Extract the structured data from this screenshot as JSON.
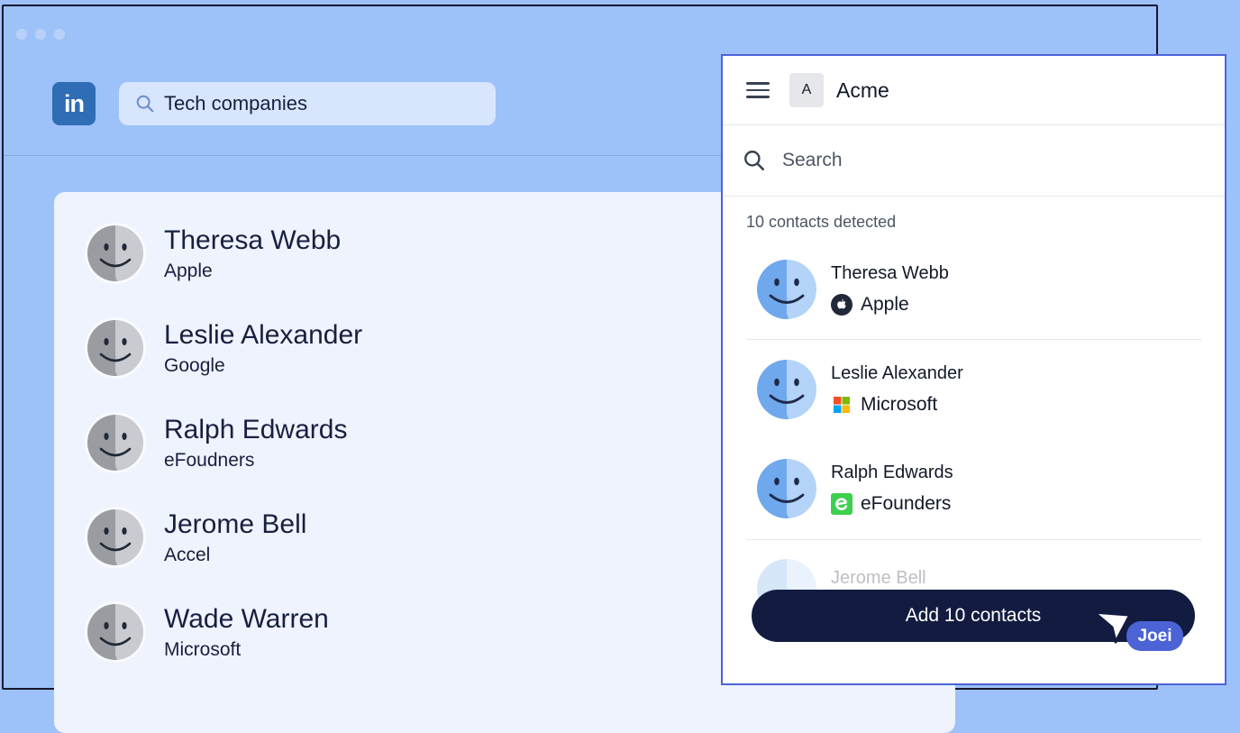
{
  "linkedin": {
    "logo_text": "in",
    "search_query": "Tech companies",
    "contacts": [
      {
        "name": "Theresa Webb",
        "company": "Apple"
      },
      {
        "name": "Leslie Alexander",
        "company": "Google"
      },
      {
        "name": "Ralph Edwards",
        "company": "eFoudners"
      },
      {
        "name": "Jerome Bell",
        "company": "Accel"
      },
      {
        "name": "Wade Warren",
        "company": "Microsoft"
      }
    ]
  },
  "extension": {
    "workspace_initial": "A",
    "workspace_name": "Acme",
    "search_placeholder": "Search",
    "detected_label": "10 contacts detected",
    "contacts": [
      {
        "name": "Theresa Webb",
        "company": "Apple",
        "logo": "apple-icon"
      },
      {
        "name": "Leslie Alexander",
        "company": "Microsoft",
        "logo": "microsoft-icon"
      },
      {
        "name": "Ralph Edwards",
        "company": "eFounders",
        "logo": "efounders-icon"
      },
      {
        "name": "Jerome Bell",
        "company": "",
        "logo": ""
      }
    ],
    "add_button_label": "Add 10 contacts"
  },
  "cursor": {
    "user_label": "Joei"
  },
  "colors": {
    "background": "#9dc1f9",
    "linkedin_blue": "#2f6db5",
    "button_navy": "#131c40",
    "accent": "#4c63d6"
  }
}
